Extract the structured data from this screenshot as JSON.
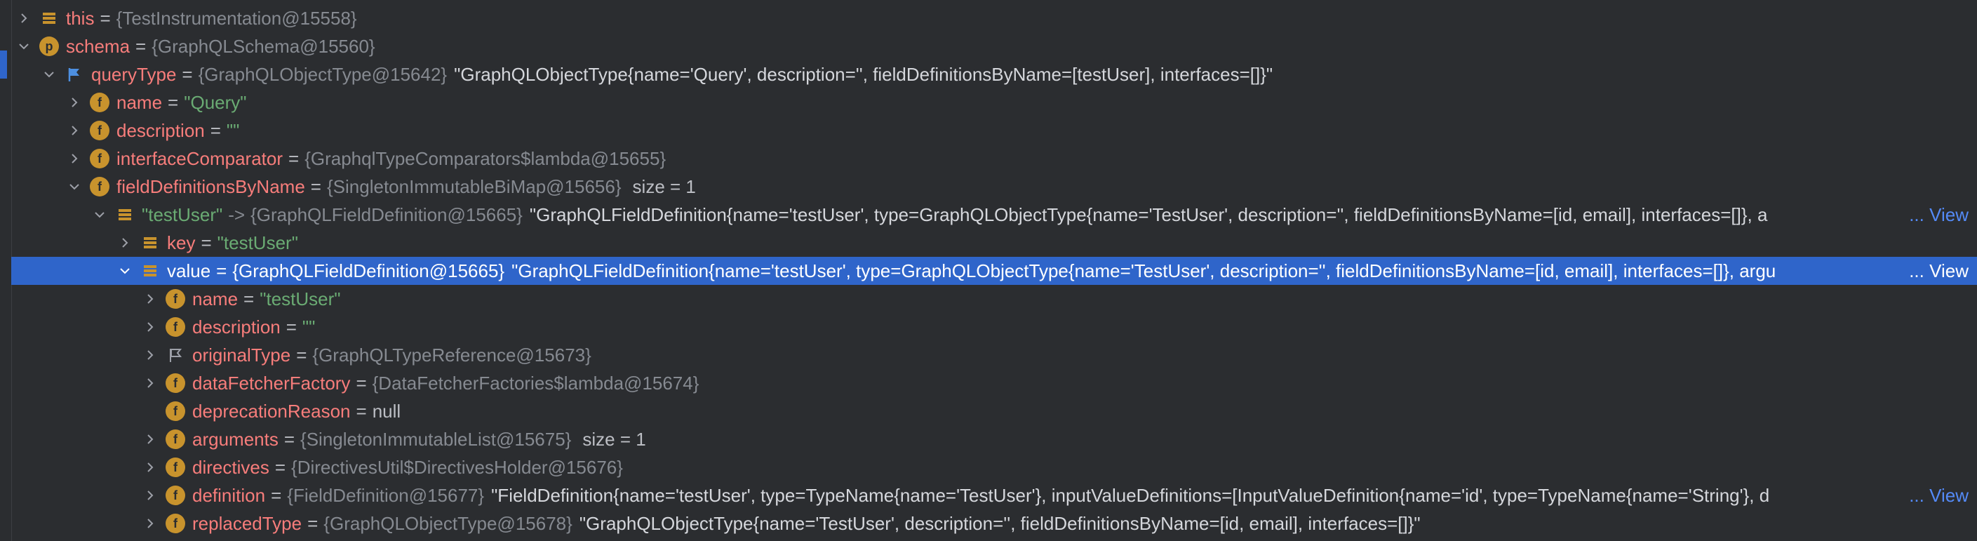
{
  "rows": [
    {
      "name": "this",
      "ref": "{TestInstrumentation@15558}"
    },
    {
      "name": "schema",
      "ref": "{GraphQLSchema@15560}"
    },
    {
      "name": "queryType",
      "ref": "{GraphQLObjectType@15642}",
      "desc": "\"GraphQLObjectType{name='Query', description='', fieldDefinitionsByName=[testUser], interfaces=[]}\""
    },
    {
      "name": "name",
      "value": "\"Query\""
    },
    {
      "name": "description",
      "value": "\"\""
    },
    {
      "name": "interfaceComparator",
      "ref": "{GraphqlTypeComparators$lambda@15655}"
    },
    {
      "name": "fieldDefinitionsByName",
      "ref": "{SingletonImmutableBiMap@15656}",
      "extra": "size = 1"
    },
    {
      "key": "\"testUser\"",
      "arrow": "->",
      "ref": "{GraphQLFieldDefinition@15665}",
      "desc": "\"GraphQLFieldDefinition{name='testUser', type=GraphQLObjectType{name='TestUser', description='', fieldDefinitionsByName=[id, email], interfaces=[]}, a",
      "link": "View"
    },
    {
      "name": "key",
      "value": "\"testUser\""
    },
    {
      "name": "value",
      "ref": "{GraphQLFieldDefinition@15665}",
      "desc": "\"GraphQLFieldDefinition{name='testUser', type=GraphQLObjectType{name='TestUser', description='', fieldDefinitionsByName=[id, email], interfaces=[]}, argu",
      "link": "View"
    },
    {
      "name": "name",
      "value": "\"testUser\""
    },
    {
      "name": "description",
      "value": "\"\""
    },
    {
      "name": "originalType",
      "ref": "{GraphQLTypeReference@15673}"
    },
    {
      "name": "dataFetcherFactory",
      "ref": "{DataFetcherFactories$lambda@15674}"
    },
    {
      "name": "deprecationReason",
      "plain": "null"
    },
    {
      "name": "arguments",
      "ref": "{SingletonImmutableList@15675}",
      "extra": "size = 1"
    },
    {
      "name": "directives",
      "ref": "{DirectivesUtil$DirectivesHolder@15676}"
    },
    {
      "name": "definition",
      "ref": "{FieldDefinition@15677}",
      "desc": "\"FieldDefinition{name='testUser', type=TypeName{name='TestUser'}, inputValueDefinitions=[InputValueDefinition{name='id', type=TypeName{name='String'}, d",
      "link": "View"
    },
    {
      "name": "replacedType",
      "ref": "{GraphQLObjectType@15678}",
      "desc": "\"GraphQLObjectType{name='TestUser', description='', fieldDefinitionsByName=[id, email], interfaces=[]}\""
    }
  ],
  "ellipsis": "...",
  "field_badge": "f",
  "param_badge": "p",
  "colors": {
    "background": "#2b2d30",
    "selection": "#2f65ca",
    "name": "#f77d7b",
    "string": "#6aab73",
    "reference": "#868a91",
    "link": "#548af7",
    "field_icon": "#c8932d"
  },
  "icons": [
    "chevron-right-icon",
    "chevron-down-icon",
    "field-icon",
    "parameter-icon",
    "list-icon",
    "flag-icon"
  ]
}
